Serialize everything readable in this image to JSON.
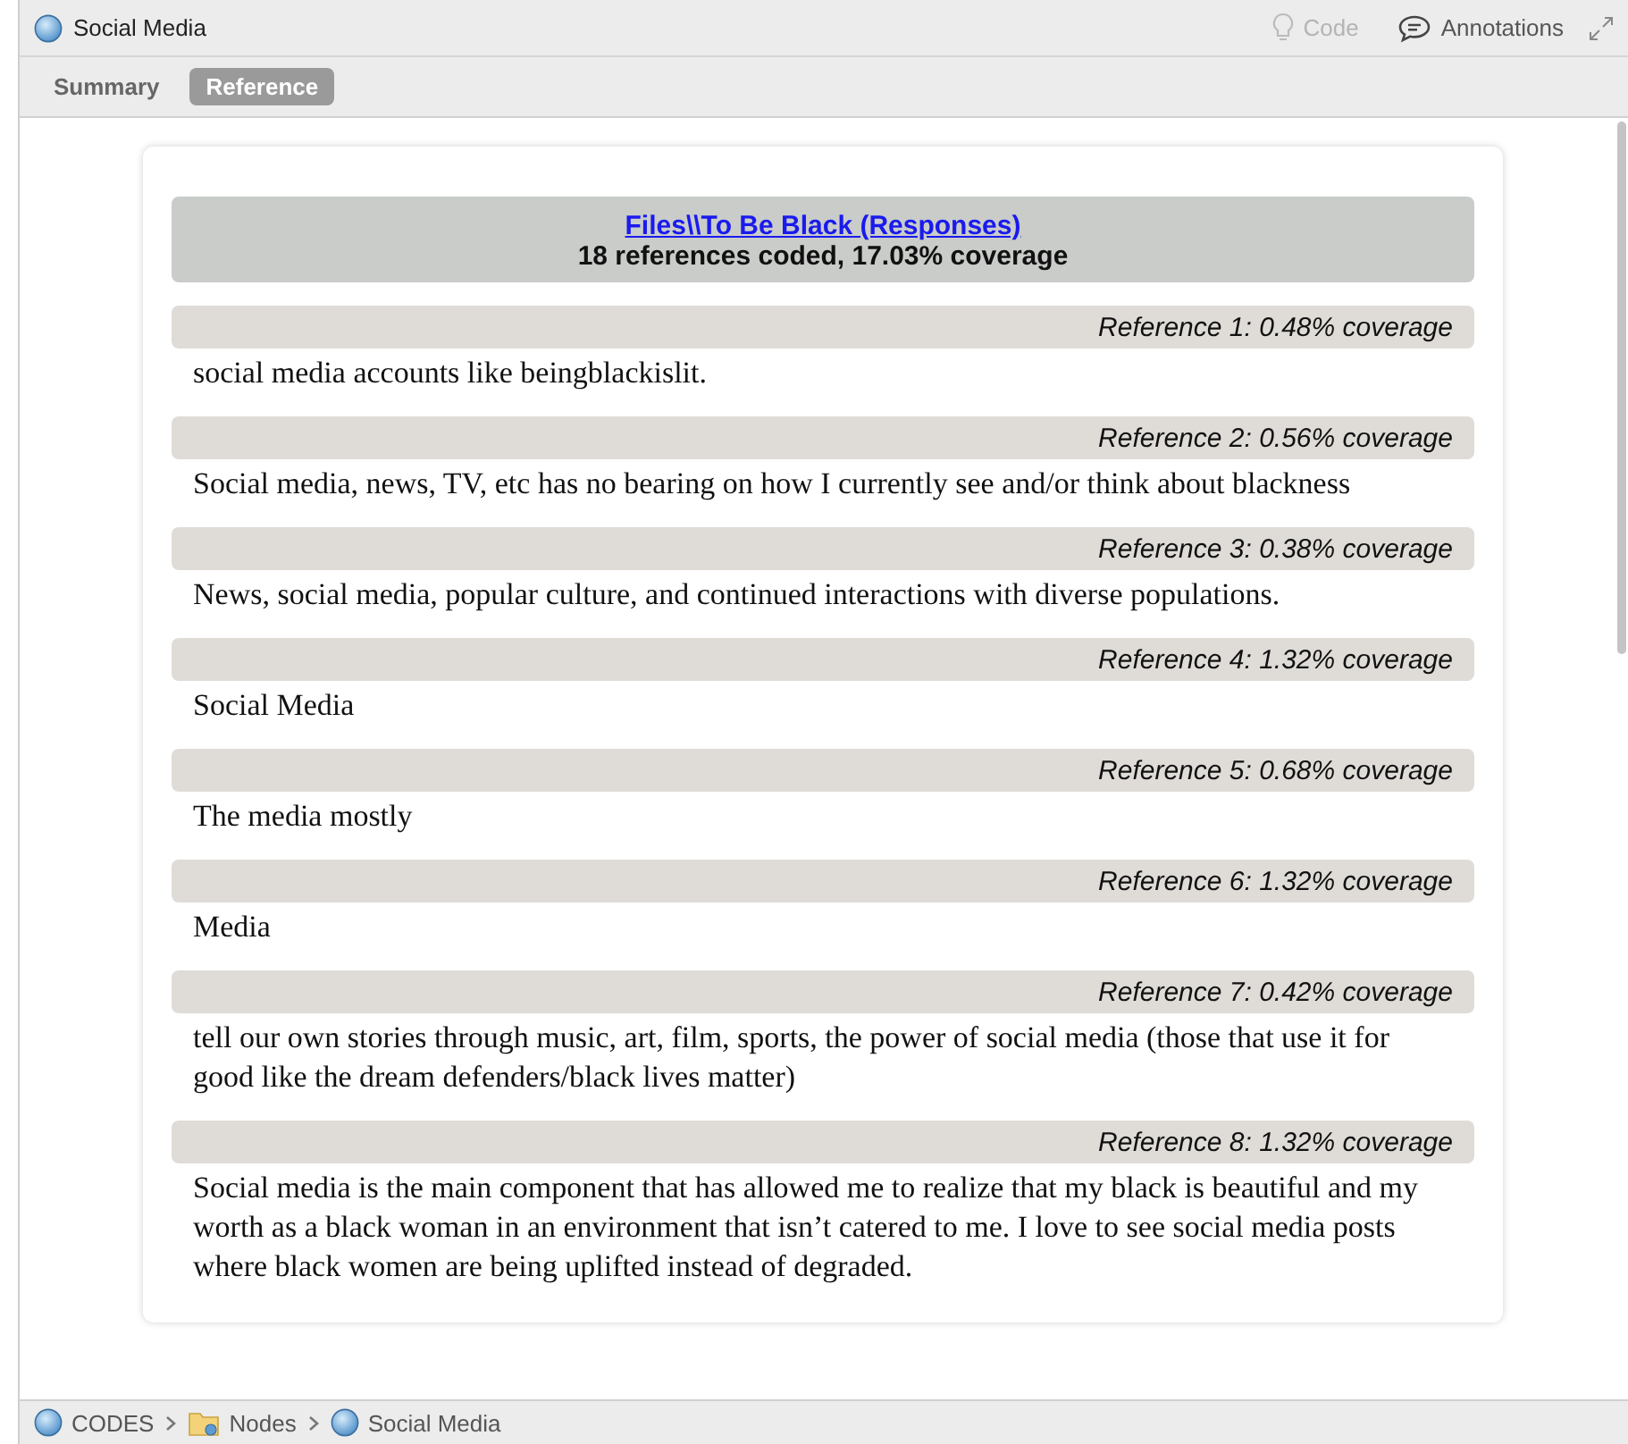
{
  "window": {
    "title": "Social Media"
  },
  "toolbar": [
    {
      "label": "Code",
      "kind": "bulb",
      "disabled": true
    },
    {
      "label": "Annotations",
      "kind": "comment",
      "disabled": false
    }
  ],
  "tabs": [
    {
      "label": "Summary",
      "selected": false
    },
    {
      "label": "Reference",
      "selected": true
    }
  ],
  "document": {
    "source_link": "Files\\\\To Be Black (Responses)",
    "summary": "18 references coded, 17.03% coverage",
    "references": [
      {
        "header": "Reference 1: 0.48% coverage",
        "text": "social media accounts like beingblackislit."
      },
      {
        "header": "Reference 2: 0.56% coverage",
        "text": "Social media, news, TV, etc has no bearing on how I currently see and/or think about blackness"
      },
      {
        "header": "Reference 3: 0.38% coverage",
        "text": "News, social media, popular culture, and continued interactions with diverse populations."
      },
      {
        "header": "Reference 4: 1.32% coverage",
        "text": "Social Media"
      },
      {
        "header": "Reference 5: 0.68% coverage",
        "text": "The media mostly"
      },
      {
        "header": "Reference 6: 1.32% coverage",
        "text": "Media"
      },
      {
        "header": "Reference 7: 0.42% coverage",
        "text": "tell our own stories through music, art, film, sports, the power of social media (those that use it for good like the dream defenders/black lives matter)"
      },
      {
        "header": "Reference 8: 1.32% coverage",
        "text": "Social media is the main component that has allowed me to realize that my black is beautiful and my worth as a black woman in an environment that isn’t catered to me. I love to see social media posts where black women are being uplifted instead of degraded."
      }
    ]
  },
  "breadcrumb": [
    {
      "label": "CODES",
      "kind": "node"
    },
    {
      "label": "Nodes",
      "kind": "folder"
    },
    {
      "label": "Social Media",
      "kind": "node"
    }
  ]
}
